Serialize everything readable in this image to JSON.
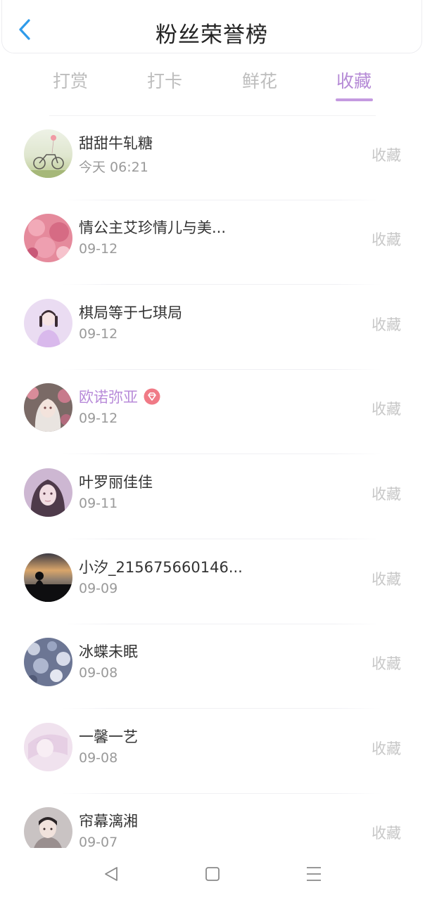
{
  "header": {
    "title": "粉丝荣誉榜"
  },
  "icons": {
    "back": "chevron-left-icon",
    "badge": "diamond-badge-icon",
    "nav_back": "triangle-back-icon",
    "nav_home": "square-home-icon",
    "nav_menu": "three-lines-menu-icon"
  },
  "colors": {
    "accent": "#b58ad6",
    "back_icon": "#2f9bea",
    "badge": "#f07a86"
  },
  "tabs": [
    {
      "label": "打赏",
      "active": false
    },
    {
      "label": "打卡",
      "active": false
    },
    {
      "label": "鲜花",
      "active": false
    },
    {
      "label": "收藏",
      "active": true
    }
  ],
  "fans": [
    {
      "name": "甜甜牛轧糖",
      "date": "今天 06:21",
      "action": "收藏",
      "vip": false
    },
    {
      "name": "情公主艾珍情儿与美...",
      "date": "09-12",
      "action": "收藏",
      "vip": false
    },
    {
      "name": "棋局等于七琪局",
      "date": "09-12",
      "action": "收藏",
      "vip": false
    },
    {
      "name": "欧诺弥亚",
      "date": "09-12",
      "action": "收藏",
      "vip": true
    },
    {
      "name": "叶罗丽佳佳",
      "date": "09-11",
      "action": "收藏",
      "vip": false
    },
    {
      "name": "小汐_215675660146...",
      "date": "09-09",
      "action": "收藏",
      "vip": false
    },
    {
      "name": "冰蝶未眠",
      "date": "09-08",
      "action": "收藏",
      "vip": false
    },
    {
      "name": "一馨一艺",
      "date": "09-08",
      "action": "收藏",
      "vip": false
    },
    {
      "name": "帘幕漓湘",
      "date": "09-07",
      "action": "收藏",
      "vip": false
    }
  ]
}
